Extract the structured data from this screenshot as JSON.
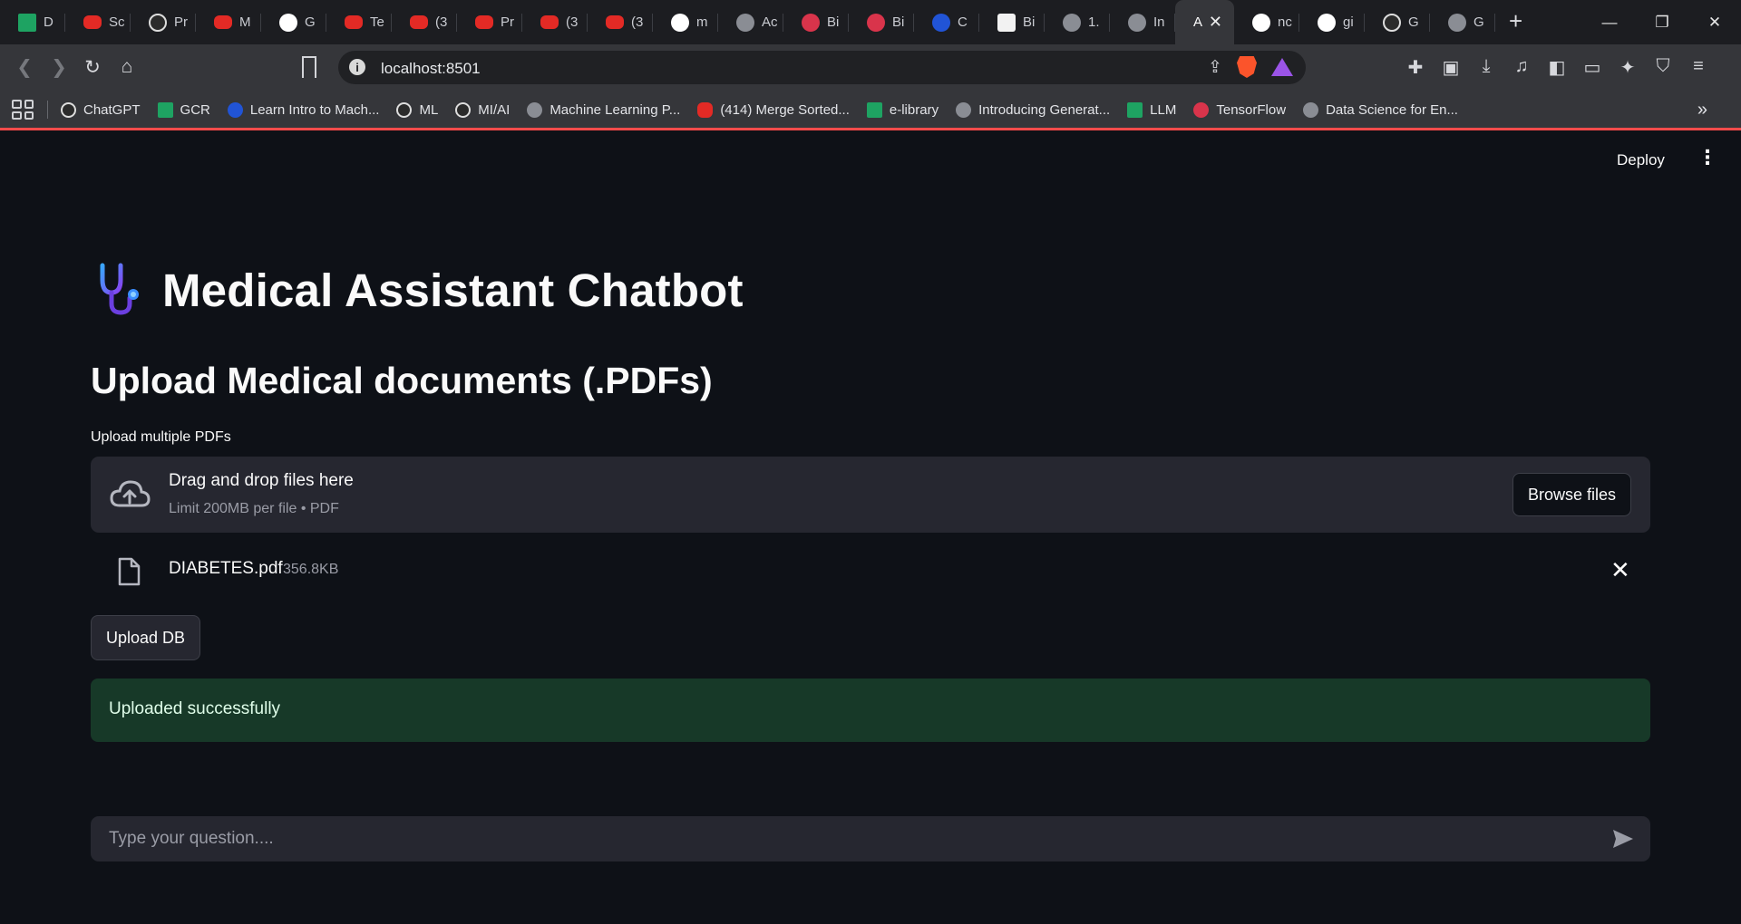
{
  "browser": {
    "tabs": [
      {
        "label": "D",
        "favicon": "sheets-icon"
      },
      {
        "label": "Sc",
        "favicon": "youtube-icon"
      },
      {
        "label": "Pr",
        "favicon": "amazon-icon"
      },
      {
        "label": "M",
        "favicon": "youtube-icon"
      },
      {
        "label": "G",
        "favicon": "github-icon"
      },
      {
        "label": "Te",
        "favicon": "youtube-icon"
      },
      {
        "label": "(3",
        "favicon": "youtube-icon"
      },
      {
        "label": "Pr",
        "favicon": "youtube-icon"
      },
      {
        "label": "(3",
        "favicon": "youtube-icon"
      },
      {
        "label": "(3",
        "favicon": "youtube-icon"
      },
      {
        "label": "m",
        "favicon": "github-icon"
      },
      {
        "label": "Ac",
        "favicon": "site-icon"
      },
      {
        "label": "Bi",
        "favicon": "red-logo-icon"
      },
      {
        "label": "Bi",
        "favicon": "red-logo-icon"
      },
      {
        "label": "C",
        "favicon": "blue-logo-icon"
      },
      {
        "label": "Bi",
        "favicon": "anthropic-icon"
      },
      {
        "label": "1.",
        "favicon": "globe-icon"
      },
      {
        "label": "In",
        "favicon": "site-icon"
      },
      {
        "label": "A",
        "favicon": "",
        "active": true
      },
      {
        "label": "nc",
        "favicon": "github-icon"
      },
      {
        "label": "gi",
        "favicon": "google-icon"
      },
      {
        "label": "G",
        "favicon": "openai-icon"
      },
      {
        "label": "G",
        "favicon": "globe-icon"
      }
    ],
    "url": "localhost:8501",
    "bookmarks": [
      {
        "label": "ChatGPT",
        "favicon": "openai-icon"
      },
      {
        "label": "GCR",
        "favicon": "classroom-icon"
      },
      {
        "label": "Learn Intro to Mach...",
        "favicon": "kaggle-icon"
      },
      {
        "label": "ML",
        "favicon": "edx-icon"
      },
      {
        "label": "MI/AI",
        "favicon": "edx-icon"
      },
      {
        "label": "Machine Learning P...",
        "favicon": "site-icon"
      },
      {
        "label": "(414) Merge Sorted...",
        "favicon": "youtube-icon"
      },
      {
        "label": "e-library",
        "favicon": "library-icon"
      },
      {
        "label": "Introducing Generat...",
        "favicon": "site-icon"
      },
      {
        "label": "LLM",
        "favicon": "nvidia-icon"
      },
      {
        "label": "TensorFlow",
        "favicon": "tensorflow-icon"
      },
      {
        "label": "Data Science for En...",
        "favicon": "site-icon"
      }
    ]
  },
  "app": {
    "deploy_label": "Deploy",
    "title": "Medical Assistant Chatbot",
    "title_icon": "stethoscope-icon",
    "subtitle": "Upload Medical documents (.PDFs)",
    "uploader": {
      "label": "Upload multiple PDFs",
      "drop_text": "Drag and drop files here",
      "limit_text": "Limit 200MB per file • PDF",
      "browse_label": "Browse files"
    },
    "file": {
      "name": "DIABETES.pdf",
      "size": "356.8KB"
    },
    "upload_db_label": "Upload DB",
    "success_message": "Uploaded successfully",
    "chat_placeholder": "Type your question....",
    "colors": {
      "background": "#0e1117",
      "widget": "#262730",
      "success_bg": "#173928",
      "success_text": "#dffde9",
      "accent": "#ff4b4b"
    }
  }
}
